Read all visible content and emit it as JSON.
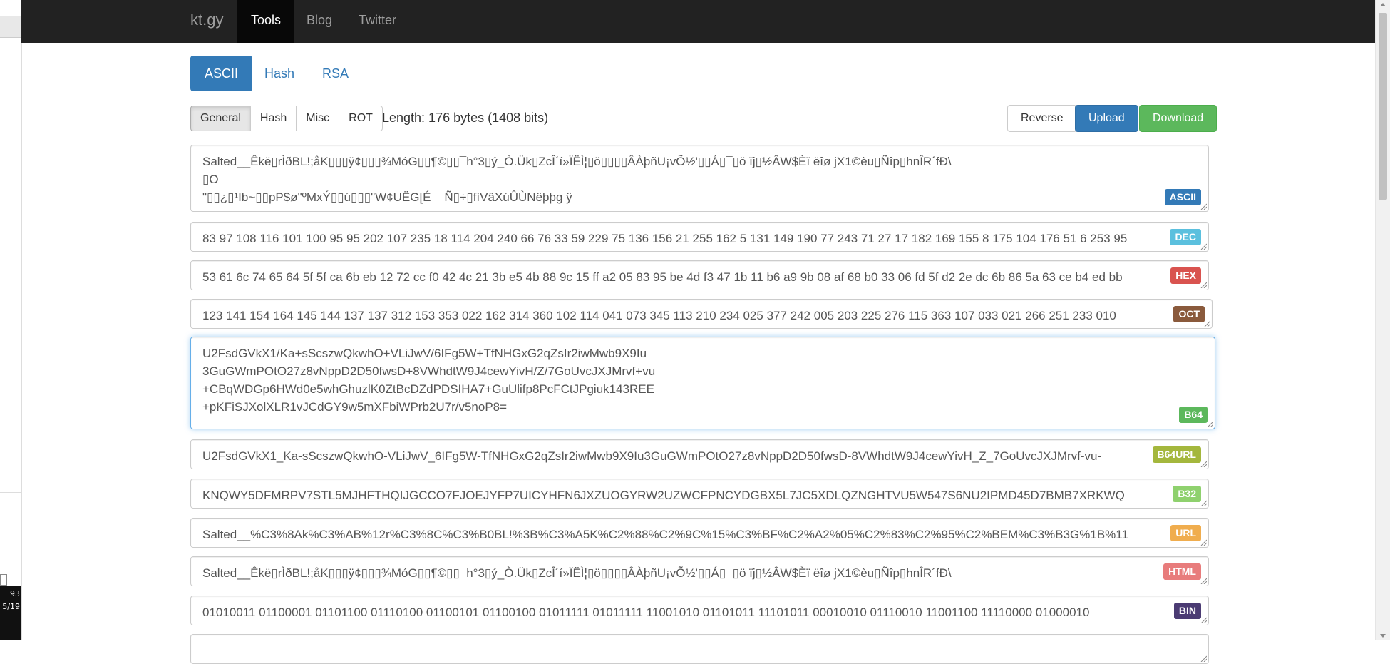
{
  "taskbar": {
    "line1": "93",
    "line2": "5/19"
  },
  "nav": {
    "brand": "kt.gy",
    "items": [
      {
        "label": "Tools",
        "active": true
      },
      {
        "label": "Blog",
        "active": false
      },
      {
        "label": "Twitter",
        "active": false
      }
    ]
  },
  "tabs": {
    "ascii": "ASCII",
    "hash": "Hash",
    "rsa": "RSA"
  },
  "subtabs": {
    "general": "General",
    "hash": "Hash",
    "misc": "Misc",
    "rot": "ROT"
  },
  "length_text": "Length: 176 bytes (1408 bits)",
  "buttons": {
    "reverse": "Reverse",
    "upload": "Upload",
    "download": "Download"
  },
  "fields": {
    "ascii": {
      "badge": "ASCII",
      "color": "#337ab7",
      "value": "Salted__Êkë▯rÌðBL!;åK▯▯▯ÿ¢▯▯▯¾MóG▯▯¶©▯▯¯h°3▯ý_Ò.Ük▯ZcÎ´í»ÏËÌ¦▯ö▯▯▯▯ÂÀþñU¡vÕ½'▯▯Á▯¯▯ö ïj▯½ÂW$Èï ëîø jX1©èu▯Ñîp▯hnÎR´fÐ\\\n▯O\n\"▯▯¿▯¹Ib~▯▯pP$ø\"ºMxÝ▯▯ú▯▯▯\"W¢UËG[É    Ñ▯÷▯fìVâXúÛÙNëþþg ÿ"
    },
    "dec": {
      "badge": "DEC",
      "color": "#5bc0de",
      "value": "83 97 108 116 101 100 95 95 202 107 235 18 114 204 240 66 76 33 59 229 75 136 156 21 255 162 5 131 149 190 77 243 71 27 17 182 169 155 8 175 104 176 51 6 253 95"
    },
    "hex": {
      "badge": "HEX",
      "color": "#d9534f",
      "value": "53 61 6c 74 65 64 5f 5f ca 6b eb 12 72 cc f0 42 4c 21 3b e5 4b 88 9c 15 ff a2 05 83 95 be 4d f3 47 1b 11 b6 a9 9b 08 af 68 b0 33 06 fd 5f d2 2e dc 6b 86 5a 63 ce b4 ed bb"
    },
    "oct": {
      "badge": "OCT",
      "color": "#8a5a3c",
      "value": "123 141 154 164 145 144 137 137 312 153 353 022 162 314 360 102 114 041 073 345 113 210 234 025 377 242 005 203 225 276 115 363 107 033 021 266 251 233 010"
    },
    "b64": {
      "badge": "B64",
      "color": "#5cb85c",
      "value": "U2FsdGVkX1/Ka+sScszwQkwhO+VLiJwV/6IFg5W+TfNHGxG2qZsIr2iwMwb9X9Iu\n3GuGWmPOtO27z8vNppD2D50fwsD+8VWhdtW9J4cewYivH/Z/7GoUvcJXJMrvf+vu\n+CBqWDGp6HWd0e5whGhuzlK0ZtBcDZdPDSIHA7+GuUlifp8PcFCtJPgiuk143REE\n+pKFiSJXolXLR1vJCdGY9w5mXFbiWPrb2U7r/v5noP8="
    },
    "b64url": {
      "badge": "B64URL",
      "color": "#a4b73d",
      "value": "U2FsdGVkX1_Ka-sScszwQkwhO-VLiJwV_6IFg5W-TfNHGxG2qZsIr2iwMwb9X9Iu3GuGWmPOtO27z8vNppD2D50fwsD-8VWhdtW9J4cewYivH_Z_7GoUvcJXJMrvf-vu-"
    },
    "b32": {
      "badge": "B32",
      "color": "#8fd16e",
      "value": "KNQWY5DFMRPV7STL5MJHFTHQIJGCCO7FJOEJYFP7UICYHFN6JXZUOGYRW2UZWCFPNCYDGBX5L7JC5XDLQZNGHTVU5W547S6NU2IPMD45D7BMB7XRKWQ"
    },
    "url": {
      "badge": "URL",
      "color": "#f0ad4e",
      "value": "Salted__%C3%8Ak%C3%AB%12r%C3%8C%C3%B0BL!%3B%C3%A5K%C2%88%C2%9C%15%C3%BF%C2%A2%05%C2%83%C2%95%C2%BEM%C3%B3G%1B%11"
    },
    "html": {
      "badge": "HTML",
      "color": "#e87c7c",
      "value": "Salted__Êkë▯rÌðBL!;åK▯▯▯ÿ¢▯▯▯¾MóG▯▯¶©▯▯¯h°3▯ý_Ò.Ük▯ZcÎ´í»ÏËÌ¦▯ö▯▯▯▯ÂÀþñU¡vÕ½'▯▯Á▯¯▯ö ïj▯½ÂW$Èï ëîø jX1©èu▯Ñîp▯hnÎR´fÐ\\"
    },
    "bin": {
      "badge": "BIN",
      "color": "#4b3b73",
      "value": "01010011 01100001 01101100 01110100 01100101 01100100 01011111 01011111 11001010 01101011 11101011 00010010 01110010 11001100 11110000 01000010"
    }
  }
}
